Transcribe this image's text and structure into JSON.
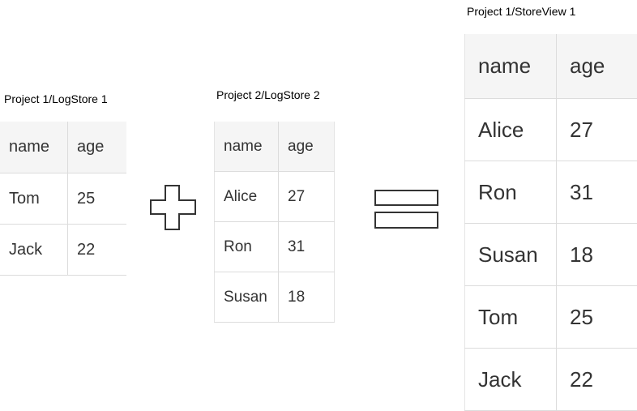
{
  "tables": [
    {
      "title": "Project 1/LogStore 1",
      "columns": [
        "name",
        "age"
      ],
      "rows": [
        [
          "Tom",
          "25"
        ],
        [
          "Jack",
          "22"
        ]
      ]
    },
    {
      "title": "Project 2/LogStore 2",
      "columns": [
        "name",
        "age"
      ],
      "rows": [
        [
          "Alice",
          "27"
        ],
        [
          "Ron",
          "31"
        ],
        [
          "Susan",
          "18"
        ]
      ]
    },
    {
      "title": "Project 1/StoreView 1",
      "columns": [
        "name",
        "age"
      ],
      "rows": [
        [
          "Alice",
          "27"
        ],
        [
          "Ron",
          "31"
        ],
        [
          "Susan",
          "18"
        ],
        [
          "Tom",
          "25"
        ],
        [
          "Jack",
          "22"
        ]
      ]
    }
  ],
  "operators": {
    "first": "plus-icon",
    "second": "equals-icon"
  },
  "colors": {
    "stroke": "#333333",
    "header_bg": "#f5f5f5",
    "grid": "#dcdcdc"
  }
}
